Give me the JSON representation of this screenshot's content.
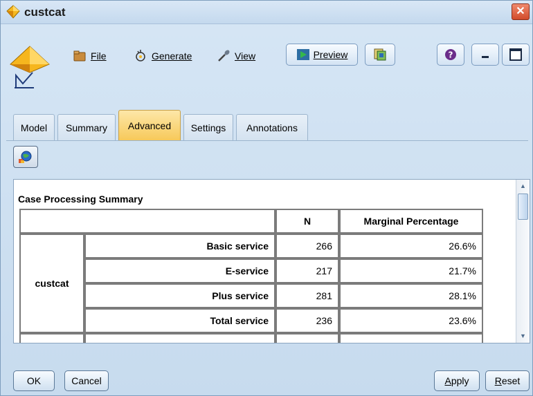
{
  "window": {
    "title": "custcat"
  },
  "menu": {
    "file": "File",
    "generate": "Generate",
    "view": "View",
    "preview": "Preview"
  },
  "tabs": [
    {
      "label": "Model"
    },
    {
      "label": "Summary"
    },
    {
      "label": "Advanced",
      "active": true
    },
    {
      "label": "Settings"
    },
    {
      "label": "Annotations"
    }
  ],
  "output": {
    "title": "Case Processing Summary",
    "headers": {
      "n": "N",
      "marginal": "Marginal Percentage"
    },
    "group_label": "custcat",
    "rows": [
      {
        "label": "Basic service",
        "n": "266",
        "pct": "26.6%"
      },
      {
        "label": "E-service",
        "n": "217",
        "pct": "21.7%"
      },
      {
        "label": "Plus service",
        "n": "281",
        "pct": "28.1%"
      },
      {
        "label": "Total service",
        "n": "236",
        "pct": "23.6%"
      }
    ]
  },
  "buttons": {
    "ok": "OK",
    "cancel": "Cancel",
    "apply": "Apply",
    "reset": "Reset"
  },
  "icons": {
    "app": "diamond-model-icon",
    "file": "folder-icon",
    "generate": "generate-icon",
    "view": "eyedropper-icon",
    "preview": "play-icon",
    "copy": "copy-icon",
    "help": "help-icon",
    "minimize": "minimize-icon",
    "maximize": "maximize-icon",
    "close": "close-icon",
    "model": "model-nugget-icon",
    "globe": "globe-icon"
  },
  "colors": {
    "accent_tab": "#f7c95a",
    "close": "#d24b2a",
    "background": "#c9ddf0"
  }
}
